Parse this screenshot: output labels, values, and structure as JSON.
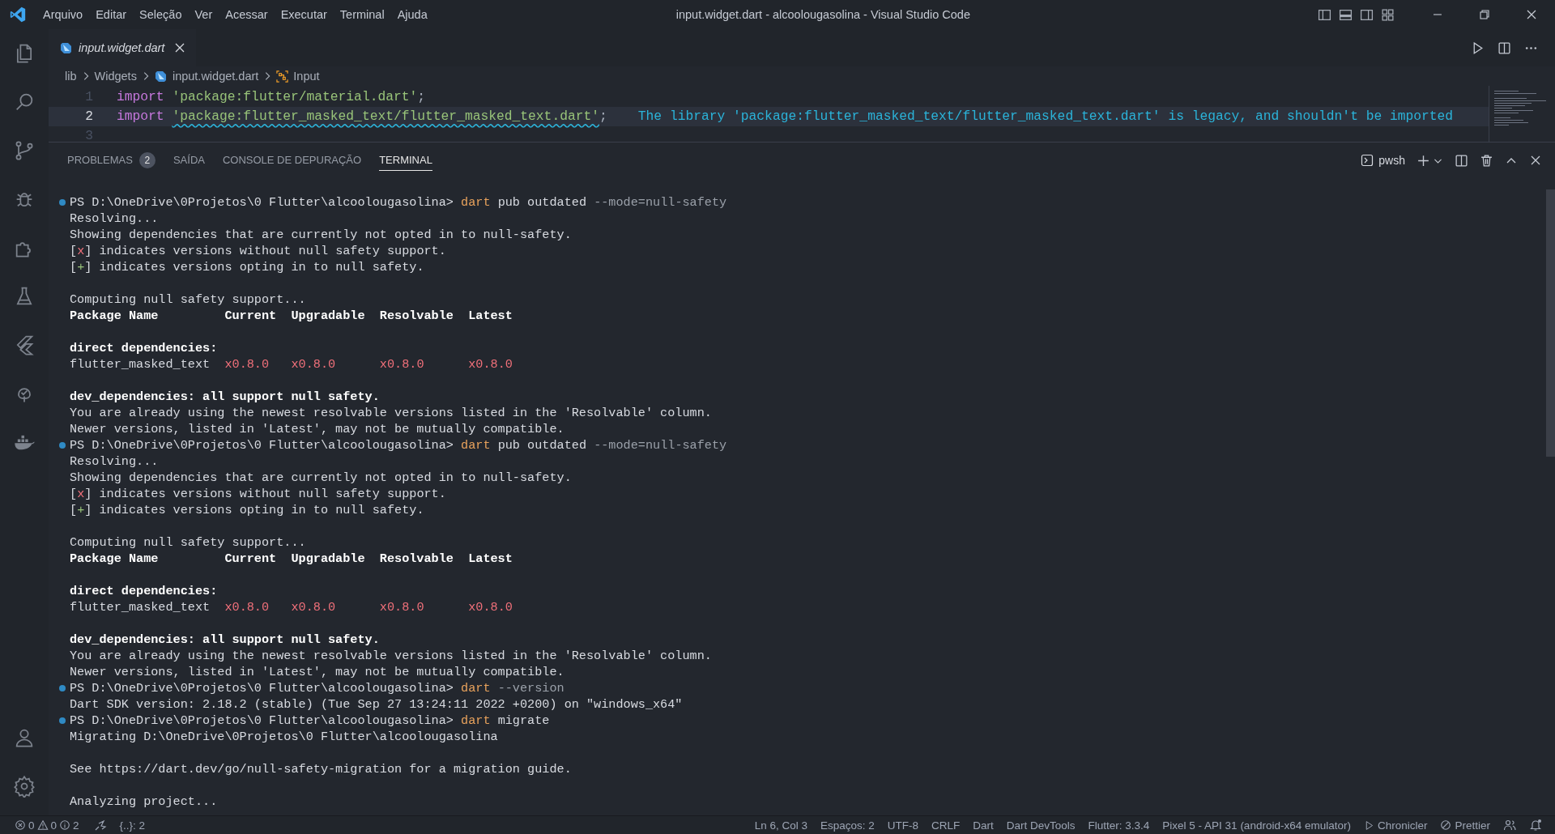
{
  "window": {
    "title": "input.widget.dart - alcoolougasolina - Visual Studio Code"
  },
  "menu": [
    "Arquivo",
    "Editar",
    "Seleção",
    "Ver",
    "Acessar",
    "Executar",
    "Terminal",
    "Ajuda"
  ],
  "editor": {
    "tab": {
      "label": "input.widget.dart"
    },
    "breadcrumb": [
      {
        "label": "lib",
        "kind": "folder"
      },
      {
        "label": "Widgets",
        "kind": "folder"
      },
      {
        "label": "input.widget.dart",
        "kind": "file"
      },
      {
        "label": "Input",
        "kind": "symbol"
      }
    ],
    "lines": [
      {
        "number": "1",
        "current": false,
        "tokens": [
          {
            "text": "import ",
            "kind": "keyword"
          },
          {
            "text": "'package:flutter/material.dart'",
            "kind": "string"
          },
          {
            "text": ";",
            "kind": "plain"
          }
        ]
      },
      {
        "number": "2",
        "current": true,
        "tokens": [
          {
            "text": "import ",
            "kind": "keyword"
          },
          {
            "text": "'package:flutter_masked_text/flutter_masked_text.dart'",
            "kind": "warning_string"
          },
          {
            "text": ";",
            "kind": "plain"
          }
        ],
        "diagnostic": "The library 'package:flutter_masked_text/flutter_masked_text.dart' is legacy, and shouldn't be imported"
      },
      {
        "number": "3",
        "current": false
      }
    ]
  },
  "panel": {
    "tabs": [
      {
        "label": "PROBLEMAS",
        "badge": "2",
        "selected": false
      },
      {
        "label": "SAÍDA",
        "selected": false
      },
      {
        "label": "CONSOLE DE DEPURAÇÃO",
        "selected": false
      },
      {
        "label": "TERMINAL",
        "selected": true
      }
    ],
    "shell": "pwsh",
    "lines": [
      {
        "kind": "prompt",
        "segments": [
          {
            "text": "PS D:\\OneDrive\\0Projetos\\0 Flutter\\alcoolougasolina> ",
            "kind": "plain"
          },
          {
            "text": "dart",
            "kind": "command"
          },
          {
            "text": " pub outdated ",
            "kind": "plain"
          },
          {
            "text": "--mode=null-safety",
            "kind": "option"
          }
        ]
      },
      {
        "kind": "output",
        "segments": [
          {
            "text": "Resolving...",
            "kind": "plain"
          }
        ]
      },
      {
        "kind": "output",
        "segments": [
          {
            "text": "Showing dependencies that are currently not opted in to null-safety.",
            "kind": "plain"
          }
        ]
      },
      {
        "kind": "output",
        "segments": [
          {
            "text": "[",
            "kind": "plain"
          },
          {
            "text": "x",
            "kind": "error"
          },
          {
            "text": "] indicates versions without null safety support.",
            "kind": "plain"
          }
        ]
      },
      {
        "kind": "output",
        "segments": [
          {
            "text": "[",
            "kind": "plain"
          },
          {
            "text": "+",
            "kind": "success"
          },
          {
            "text": "] indicates versions opting in to null safety.",
            "kind": "plain"
          }
        ]
      },
      {
        "kind": "blank"
      },
      {
        "kind": "output",
        "segments": [
          {
            "text": "Computing null safety support...",
            "kind": "plain"
          }
        ]
      },
      {
        "kind": "output",
        "segments": [
          {
            "text": "Package Name         Current  Upgradable  Resolvable  Latest",
            "kind": "bold"
          }
        ]
      },
      {
        "kind": "blank"
      },
      {
        "kind": "output",
        "segments": [
          {
            "text": "direct dependencies:",
            "kind": "bold"
          }
        ]
      },
      {
        "kind": "output",
        "segments": [
          {
            "text": "flutter_masked_text  ",
            "kind": "plain"
          },
          {
            "text": "x0.8.0   ",
            "kind": "error"
          },
          {
            "text": "x0.8.0      ",
            "kind": "error"
          },
          {
            "text": "x0.8.0      ",
            "kind": "error"
          },
          {
            "text": "x0.8.0",
            "kind": "error"
          }
        ]
      },
      {
        "kind": "blank"
      },
      {
        "kind": "output",
        "segments": [
          {
            "text": "dev_dependencies: all support null safety.",
            "kind": "bold"
          }
        ]
      },
      {
        "kind": "output",
        "segments": [
          {
            "text": "You are already using the newest resolvable versions listed in the 'Resolvable' column.",
            "kind": "plain"
          }
        ]
      },
      {
        "kind": "output",
        "segments": [
          {
            "text": "Newer versions, listed in 'Latest', may not be mutually compatible.",
            "kind": "plain"
          }
        ]
      },
      {
        "kind": "prompt",
        "segments": [
          {
            "text": "PS D:\\OneDrive\\0Projetos\\0 Flutter\\alcoolougasolina> ",
            "kind": "plain"
          },
          {
            "text": "dart",
            "kind": "command"
          },
          {
            "text": " pub outdated ",
            "kind": "plain"
          },
          {
            "text": "--mode=null-safety",
            "kind": "option"
          }
        ]
      },
      {
        "kind": "output",
        "segments": [
          {
            "text": "Resolving...",
            "kind": "plain"
          }
        ]
      },
      {
        "kind": "output",
        "segments": [
          {
            "text": "Showing dependencies that are currently not opted in to null-safety.",
            "kind": "plain"
          }
        ]
      },
      {
        "kind": "output",
        "segments": [
          {
            "text": "[",
            "kind": "plain"
          },
          {
            "text": "x",
            "kind": "error"
          },
          {
            "text": "] indicates versions without null safety support.",
            "kind": "plain"
          }
        ]
      },
      {
        "kind": "output",
        "segments": [
          {
            "text": "[",
            "kind": "plain"
          },
          {
            "text": "+",
            "kind": "success"
          },
          {
            "text": "] indicates versions opting in to null safety.",
            "kind": "plain"
          }
        ]
      },
      {
        "kind": "blank"
      },
      {
        "kind": "output",
        "segments": [
          {
            "text": "Computing null safety support...",
            "kind": "plain"
          }
        ]
      },
      {
        "kind": "output",
        "segments": [
          {
            "text": "Package Name         Current  Upgradable  Resolvable  Latest",
            "kind": "bold"
          }
        ]
      },
      {
        "kind": "blank"
      },
      {
        "kind": "output",
        "segments": [
          {
            "text": "direct dependencies:",
            "kind": "bold"
          }
        ]
      },
      {
        "kind": "output",
        "segments": [
          {
            "text": "flutter_masked_text  ",
            "kind": "plain"
          },
          {
            "text": "x0.8.0   ",
            "kind": "error"
          },
          {
            "text": "x0.8.0      ",
            "kind": "error"
          },
          {
            "text": "x0.8.0      ",
            "kind": "error"
          },
          {
            "text": "x0.8.0",
            "kind": "error"
          }
        ]
      },
      {
        "kind": "blank"
      },
      {
        "kind": "output",
        "segments": [
          {
            "text": "dev_dependencies: all support null safety.",
            "kind": "bold"
          }
        ]
      },
      {
        "kind": "output",
        "segments": [
          {
            "text": "You are already using the newest resolvable versions listed in the 'Resolvable' column.",
            "kind": "plain"
          }
        ]
      },
      {
        "kind": "output",
        "segments": [
          {
            "text": "Newer versions, listed in 'Latest', may not be mutually compatible.",
            "kind": "plain"
          }
        ]
      },
      {
        "kind": "prompt",
        "segments": [
          {
            "text": "PS D:\\OneDrive\\0Projetos\\0 Flutter\\alcoolougasolina> ",
            "kind": "plain"
          },
          {
            "text": "dart",
            "kind": "command"
          },
          {
            "text": " --version",
            "kind": "option"
          }
        ]
      },
      {
        "kind": "output",
        "segments": [
          {
            "text": "Dart SDK version: 2.18.2 (stable) (Tue Sep 27 13:24:11 2022 +0200) on \"windows_x64\"",
            "kind": "plain"
          }
        ]
      },
      {
        "kind": "prompt",
        "segments": [
          {
            "text": "PS D:\\OneDrive\\0Projetos\\0 Flutter\\alcoolougasolina> ",
            "kind": "plain"
          },
          {
            "text": "dart",
            "kind": "command"
          },
          {
            "text": " migrate",
            "kind": "plain"
          }
        ]
      },
      {
        "kind": "output",
        "segments": [
          {
            "text": "Migrating D:\\OneDrive\\0Projetos\\0 Flutter\\alcoolougasolina",
            "kind": "plain"
          }
        ]
      },
      {
        "kind": "blank"
      },
      {
        "kind": "output",
        "segments": [
          {
            "text": "See https://dart.dev/go/null-safety-migration for a migration guide.",
            "kind": "plain"
          }
        ]
      },
      {
        "kind": "blank"
      },
      {
        "kind": "output",
        "segments": [
          {
            "text": "Analyzing project...",
            "kind": "plain"
          }
        ]
      }
    ]
  },
  "status_bar": {
    "errors": "0",
    "warnings": "0",
    "infos": "2",
    "braces": "{..}: 2",
    "items": [
      {
        "label": "Ln 6, Col 3",
        "kind": "text"
      },
      {
        "label": "Espaços: 2",
        "kind": "text"
      },
      {
        "label": "UTF-8",
        "kind": "text"
      },
      {
        "label": "CRLF",
        "kind": "text"
      },
      {
        "label": "Dart",
        "kind": "text"
      },
      {
        "label": "Dart DevTools",
        "kind": "text"
      },
      {
        "label": "Flutter: 3.3.4",
        "kind": "text"
      },
      {
        "label": "Pixel 5 - API 31 (android-x64 emulator)",
        "kind": "text"
      },
      {
        "label": "Chronicler",
        "kind": "play"
      },
      {
        "label": "Prettier",
        "kind": "blocked"
      }
    ]
  }
}
